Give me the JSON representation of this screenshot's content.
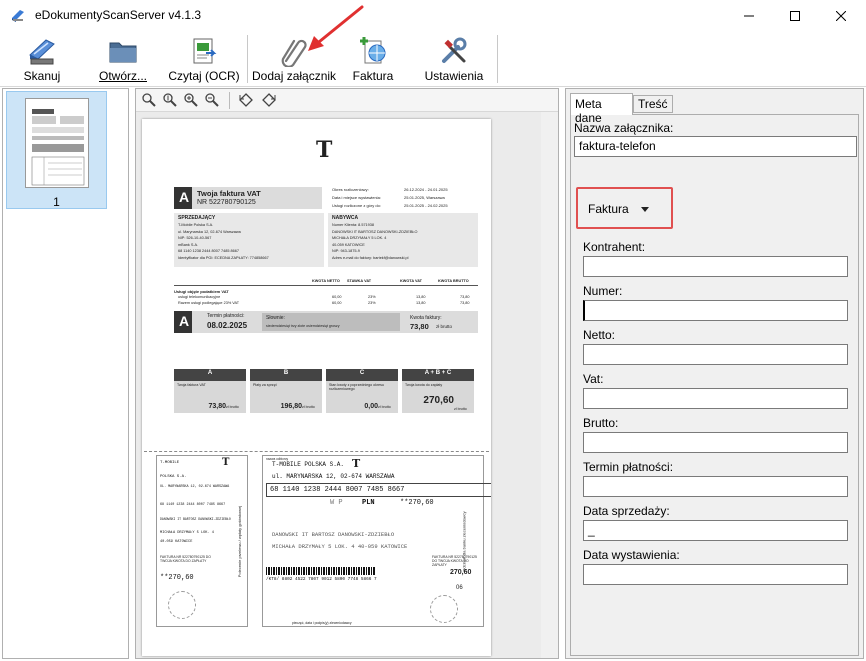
{
  "window": {
    "title": "eDokumentyScanServer v4.1.3",
    "min_glyph": "—",
    "max_glyph": "☐",
    "close_glyph": "✕"
  },
  "toolbar": {
    "scan_label": "Skanuj",
    "open_label": "Otwórz...",
    "ocr_label": "Czytaj (OCR)",
    "attach_label": "Dodaj załącznik",
    "invoice_label": "Faktura",
    "settings_label": "Ustawienia"
  },
  "thumbnails": {
    "items": [
      {
        "label": "1"
      }
    ]
  },
  "document": {
    "brand_logo": "T",
    "type_letter": "A",
    "doc_title": "Twoja faktura VAT",
    "doc_number": "NR 522780790125",
    "date_lines": [
      {
        "k": "Okres rozliczeniowy:",
        "v": "26.12.2024 - 24.01.2025"
      },
      {
        "k": "Data i miejsce wystawienia:",
        "v": "25.01.2025, Warszawa"
      },
      {
        "k": "Usługi rozliczone z góry do:",
        "v": "25.01.2025 - 24.02.2025"
      }
    ],
    "seller_header": "SPRZEDAJĄCY",
    "seller_lines": [
      "T-Mobile Polska S.A.",
      "ul. Marynarska 12, 02-674 Warszawa",
      "NIP: 526-10-40-567",
      "mBank S.A.",
      "68 1140 1238 2444 8007 7485 8667",
      "Identyfikator dla PGI: ECEDNA ZAPŁATY: 774858667"
    ],
    "buyer_header": "NABYWCA",
    "buyer_lines": [
      "Numer Klienta: 8.571938",
      "DANOWSKI IT BARTOSZ DANOWSKI-ZDZIEBŁO",
      "MICHAŁA DRZYMAŁY 5 LOK. 4",
      "40-059 KATOWICE",
      "NIP: 943-1875-9",
      "Adres e-mail do faktury: bartekf@danowski.pl"
    ],
    "table_headers": [
      "KWOTA NETTO",
      "STAWKA VAT",
      "KWOTA VAT",
      "KWOTA BRUTTO"
    ],
    "table_section": "Usługi objęte podatkiem VAT",
    "table_rows": [
      {
        "name": "usługi telekomunikacyjne",
        "netto": "60,00",
        "stawka": "23%",
        "vat": "13,80",
        "brutto": "73,80"
      },
      {
        "name": "Razem usługi podlegające 23% VAT",
        "netto": "60,00",
        "stawka": "23%",
        "vat": "13,80",
        "brutto": "73,80"
      }
    ],
    "due_label": "Termin płatności:",
    "due_date": "08.02.2025",
    "words_label": "Słownie:",
    "words_value": "siedemdziesiąt trzy złote osiemdziesiąt groszy",
    "amount_label": "Kwota faktury:",
    "amount_value": "73,80",
    "amount_unit": "zł brutto",
    "summary": [
      {
        "head": "A",
        "desc": "Twoja faktura VAT",
        "val": "73,80",
        "unit": "zł brutto"
      },
      {
        "head": "B",
        "desc": "Płaty za sprzęt",
        "val": "196,80",
        "unit": "zł brutto"
      },
      {
        "head": "C",
        "desc": "Stan kwoty z poprzedniego okresu rozliczeniowego",
        "val": "0,00",
        "unit": "zł brutto"
      },
      {
        "head": "A + B + C",
        "desc": "Twoja kwota do zapłaty",
        "val": "270,60",
        "unit": "zł brutto"
      }
    ],
    "slip": {
      "receiver_label": "nazwa odbiorcy",
      "receiver": "T-MOBILE POLSKA S.A.",
      "receiver_short": "T-MOBILE",
      "receiver_short2": "POLSKA S.A.",
      "address": "ul. MARYNARSKA 12, 02-674 WARSZAWA",
      "address_short": "UL. MARYNARSKA 12, 02-674 WARSZAWA",
      "account": "68 1140 1238 2444 8007 7485 8667",
      "account_short": "68 1140 1238 2444 8007 7485 8667",
      "wp": "W P",
      "currency": "PLN",
      "amount": "**270,60",
      "payer_name": "DANOWSKI IT BARTOSZ DANOWSKI-ZDZIEBŁO",
      "payer_addr": "MICHAŁA DRZYMAŁY 5 LOK. 4   40-059 KATOWICE",
      "payer_short1": "DANOWSKI IT BARTOSZ DANOWSKI-ZDZIEBŁO",
      "payer_short2": "MICHAŁA DRZYMAŁY 5 LOK. 4",
      "payer_short3": "40-059 KATOWICE",
      "invoice_ref": "FAKTURA NR 522780790125 DO TWOJA KWOTA DO ZAPŁATY",
      "left_amount": "**270,60",
      "ref_line": "/KT8/ 8802 4522 7807 9012 5800 7748 5866 7",
      "ref_amount": "270,60",
      "code": "06",
      "bottom_label": "pieczęć, data i podpis(y) zleceniodawcy",
      "side_left": "Potwierdzenie dla zleceniodawcy",
      "side_mid": "Polecenie przelewu / wpłaty gotówkowej",
      "side_right": "Odcinek dla banku zleceniodawcy"
    }
  },
  "meta_panel": {
    "tabs": [
      {
        "label": "Meta dane"
      },
      {
        "label": "Treść"
      }
    ],
    "attachment_name_label": "Nazwa załącznika:",
    "attachment_name_value": "faktura-telefon",
    "doc_type_selected": "Faktura",
    "fields": [
      {
        "label": "Kontrahent:",
        "value": ""
      },
      {
        "label": "Numer:",
        "value": ""
      },
      {
        "label": "Netto:",
        "value": ""
      },
      {
        "label": "Vat:",
        "value": ""
      },
      {
        "label": "Brutto:",
        "value": ""
      },
      {
        "label": "Termin płatności:",
        "value": ""
      },
      {
        "label": "Data sprzedaży:",
        "value": "_"
      },
      {
        "label": "Data wystawienia:",
        "value": ""
      }
    ]
  },
  "colors": {
    "accent_red": "#e03030",
    "magenta": "#e20074",
    "selection": "#cce4f7"
  }
}
